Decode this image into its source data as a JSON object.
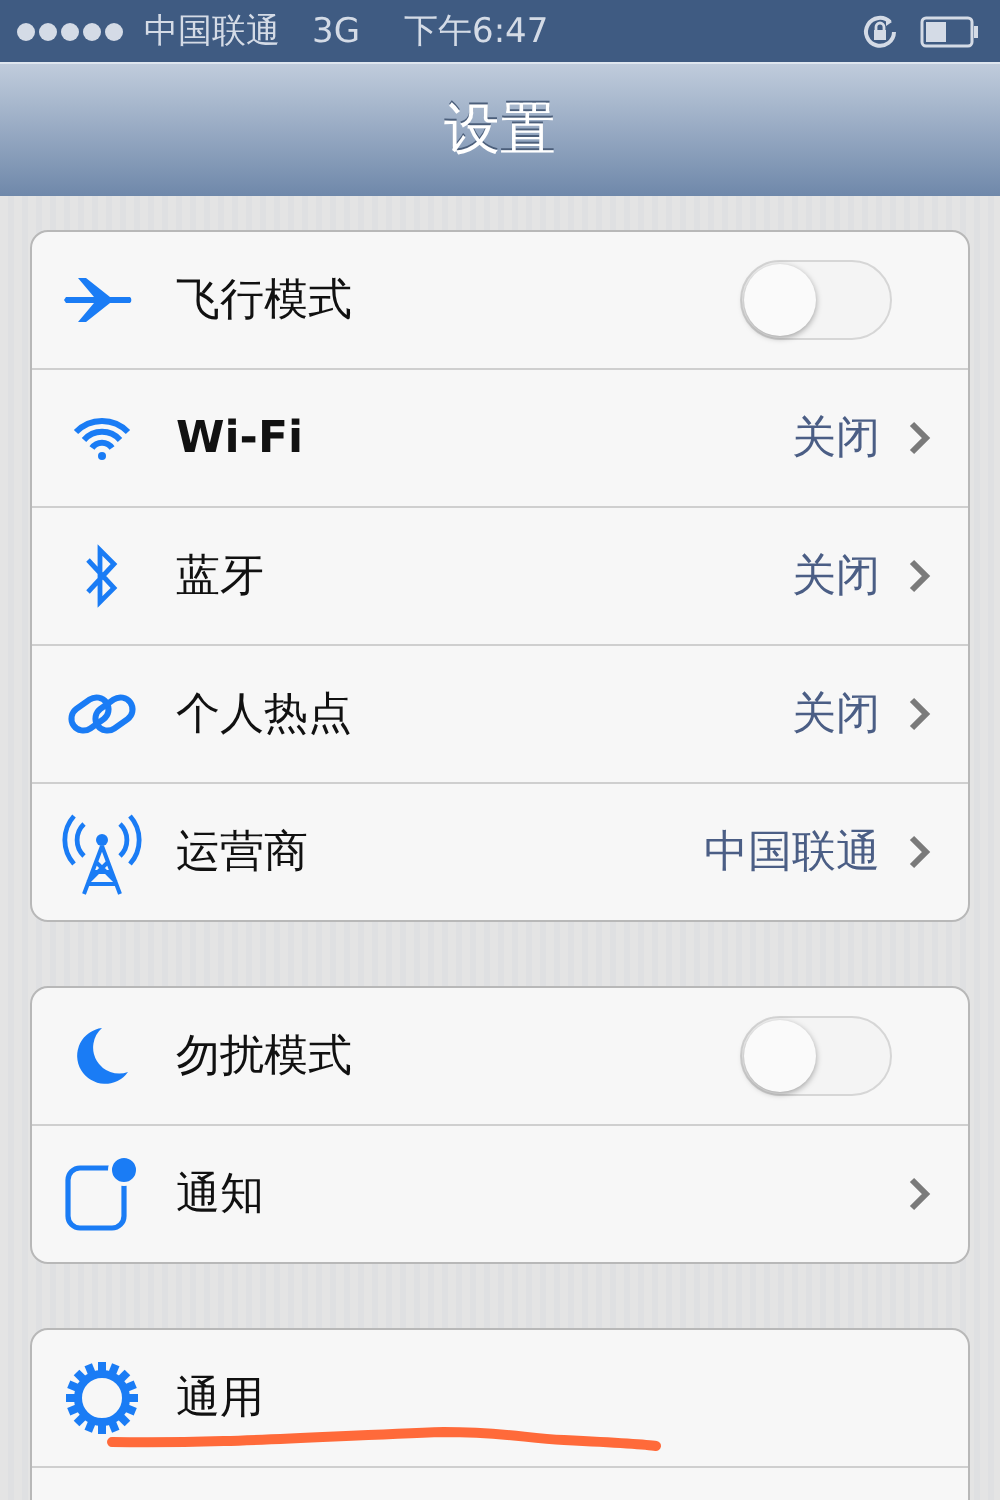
{
  "status_bar": {
    "carrier": "中国联通",
    "network": "3G",
    "time": "下午6:47"
  },
  "nav_bar": {
    "title": "设置"
  },
  "groups": [
    {
      "rows": [
        {
          "kind": "toggle",
          "label": "飞行模式",
          "bold": false,
          "on": false
        },
        {
          "kind": "link",
          "label": "Wi-Fi",
          "bold": true,
          "value": "关闭"
        },
        {
          "kind": "link",
          "label": "蓝牙",
          "bold": false,
          "value": "关闭"
        },
        {
          "kind": "link",
          "label": "个人热点",
          "bold": false,
          "value": "关闭"
        },
        {
          "kind": "link",
          "label": "运营商",
          "bold": false,
          "value": "中国联通"
        }
      ]
    },
    {
      "rows": [
        {
          "kind": "toggle",
          "label": "勿扰模式",
          "bold": false,
          "on": false
        },
        {
          "kind": "link",
          "label": "通知",
          "bold": false
        }
      ]
    },
    {
      "rows": [
        {
          "kind": "plain",
          "label": "通用",
          "bold": false,
          "scribbled": true
        },
        {
          "kind": "blank"
        }
      ]
    }
  ]
}
